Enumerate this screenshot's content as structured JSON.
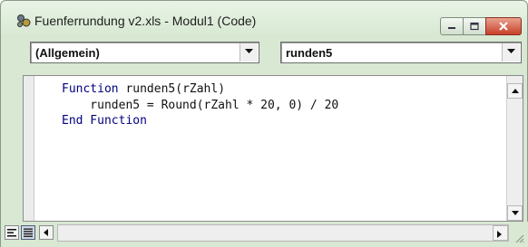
{
  "window": {
    "title": "Fuenferrundung v2.xls - Modul1 (Code)"
  },
  "combos": {
    "object": "(Allgemein)",
    "procedure": "runden5"
  },
  "code": {
    "line1_keyword": "Function",
    "line1_rest": " runden5(rZahl)",
    "line2": "    runden5 = Round(rZahl * 20, 0) / 20",
    "line3_keyword": "End Function"
  },
  "colors": {
    "keyword": "#00007f",
    "chrome": "#d8e8d3"
  }
}
